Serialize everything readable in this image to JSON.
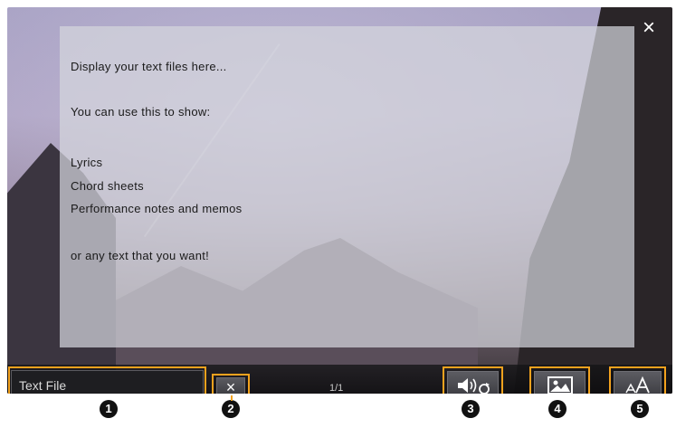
{
  "text_content": {
    "lines": [
      "Display your text files here...",
      "You can use this to show:",
      "Lyrics",
      "Chord sheets",
      "Performance notes and memos",
      "or any text that you want!"
    ]
  },
  "bottom_bar": {
    "file_name": "Text File",
    "clear_icon": "×",
    "page_indicator": "1/1",
    "close_icon": "×"
  },
  "icons": {
    "close": "close-icon",
    "clear": "clear-x-icon",
    "auto_scroll": "speaker-sync-icon",
    "image": "image-icon",
    "font_size": "font-size-icon"
  },
  "callouts": [
    "1",
    "2",
    "3",
    "4",
    "5"
  ],
  "colors": {
    "highlight": "#f3a21e",
    "callout_bg": "#111111"
  }
}
